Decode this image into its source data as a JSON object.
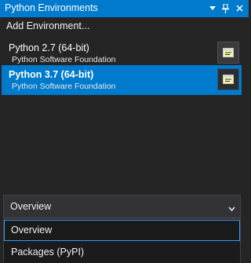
{
  "window": {
    "title": "Python Environments",
    "dropdown_glyph": "▾",
    "pin_glyph": "📌",
    "close_glyph": "✕"
  },
  "add_environment_label": "Add Environment...",
  "environments": [
    {
      "name": "Python 2.7 (64-bit)",
      "publisher": "Python Software Foundation",
      "selected": false
    },
    {
      "name": "Python 3.7 (64-bit)",
      "publisher": "Python Software Foundation",
      "selected": true
    }
  ],
  "view_selector": {
    "selected": "Overview",
    "options": [
      "Overview",
      "Packages (PyPI)"
    ],
    "highlighted_option": "Overview"
  },
  "colors": {
    "accent": "#007acc",
    "background": "#252526",
    "dropdown_bg": "#333337",
    "list_bg": "#1b1b1c",
    "focus_border": "#3399ff"
  }
}
